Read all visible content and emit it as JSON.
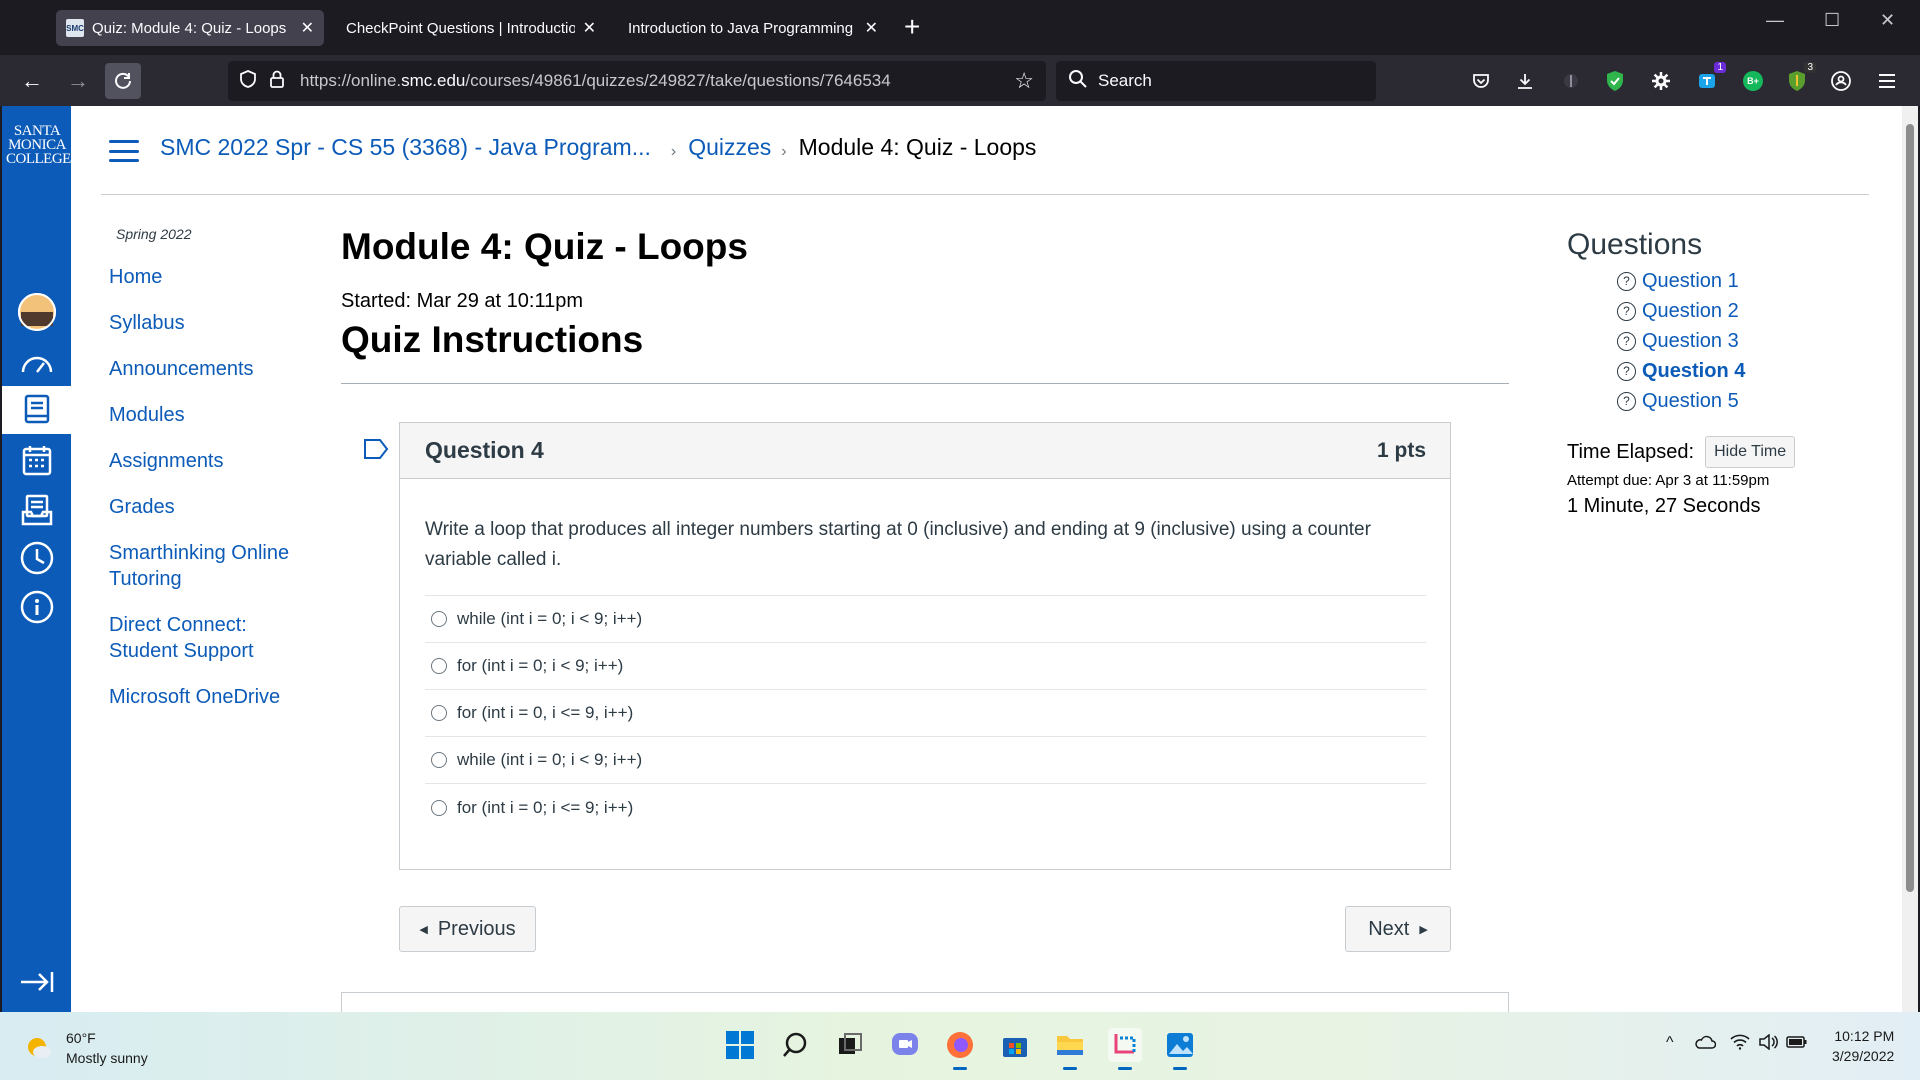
{
  "browser": {
    "tabs": [
      {
        "title": "Quiz: Module 4: Quiz - Loops",
        "active": true
      },
      {
        "title": "CheckPoint Questions | Introduction",
        "active": false
      },
      {
        "title": "Introduction to Java Programming a",
        "active": false
      }
    ],
    "url_prefix": "https://online.",
    "url_host": "smc.edu",
    "url_path": "/courses/49861/quizzes/249827/take/questions/7646534",
    "search_placeholder": "Search",
    "extension_badges": {
      "first": "1",
      "second": "3"
    },
    "ext_b_label": "B+"
  },
  "logo": {
    "line1": "SANTA",
    "line2": "MONICA",
    "line3": "COLLEGE"
  },
  "breadcrumb": {
    "course": "SMC 2022 Spr - CS 55 (3368) - Java Program...",
    "quizzes": "Quizzes",
    "current": "Module 4: Quiz - Loops"
  },
  "course_nav": {
    "term": "Spring 2022",
    "links": [
      "Home",
      "Syllabus",
      "Announcements",
      "Modules",
      "Assignments",
      "Grades",
      "Smarthinking Online Tutoring",
      "Direct Connect: Student Support",
      "Microsoft OneDrive"
    ]
  },
  "quiz": {
    "title": "Module 4: Quiz - Loops",
    "started": "Started: Mar 29 at 10:11pm",
    "instructions_heading": "Quiz Instructions",
    "question": {
      "name": "Question 4",
      "points": "1 pts",
      "text": "Write a loop that produces all integer numbers starting at 0 (inclusive) and ending at 9 (inclusive) using a counter variable called i.",
      "answers": [
        "while (int i = 0; i < 9; i++)",
        "for (int i = 0; i < 9; i++)",
        "for (int i = 0, i <= 9, i++)",
        "while (int i = 0; i < 9; i++)",
        "for (int i = 0; i <= 9; i++)"
      ]
    },
    "previous_label": "Previous",
    "next_label": "Next"
  },
  "sidebar": {
    "heading": "Questions",
    "questions": [
      "Question 1",
      "Question 2",
      "Question 3",
      "Question 4",
      "Question 5"
    ],
    "current_question": "Question 4",
    "time_label": "Time Elapsed:",
    "hide_time_label": "Hide Time",
    "attempt_due": "Attempt due: Apr 3 at 11:59pm",
    "elapsed": "1 Minute, 27 Seconds"
  },
  "taskbar": {
    "temperature": "60°F",
    "condition": "Mostly sunny",
    "time": "10:12 PM",
    "date": "3/29/2022"
  },
  "colors": {
    "canvas_blue": "#0c5bb8",
    "link": "#0c5bb8",
    "text": "#2d3b45"
  }
}
